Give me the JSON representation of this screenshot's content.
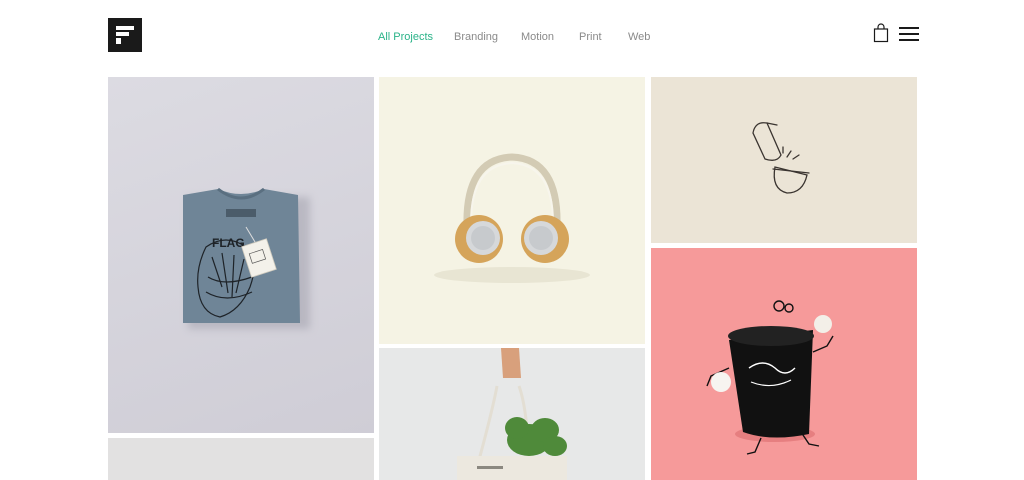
{
  "header": {
    "logo_icon": "brand-f-logo-icon",
    "filters": [
      {
        "label": "All Projects",
        "active": true
      },
      {
        "label": "Branding",
        "active": false
      },
      {
        "label": "Motion",
        "active": false
      },
      {
        "label": "Print",
        "active": false
      },
      {
        "label": "Web",
        "active": false
      }
    ],
    "cart_icon": "shopping-bag-icon",
    "menu_icon": "hamburger-menu-icon"
  },
  "colors": {
    "accent": "#2bb389",
    "filter_text": "#8a8a8a",
    "logo_bg": "#1a1a1a"
  },
  "projects": [
    {
      "name": "t-shirt-mockup",
      "shirt_print": "FLAG"
    },
    {
      "name": "headphones"
    },
    {
      "name": "pouring-cup-illustration"
    },
    {
      "name": "black-bucket-illustration"
    },
    {
      "name": "tote-bag-with-greens"
    },
    {
      "name": "project-partial"
    }
  ]
}
